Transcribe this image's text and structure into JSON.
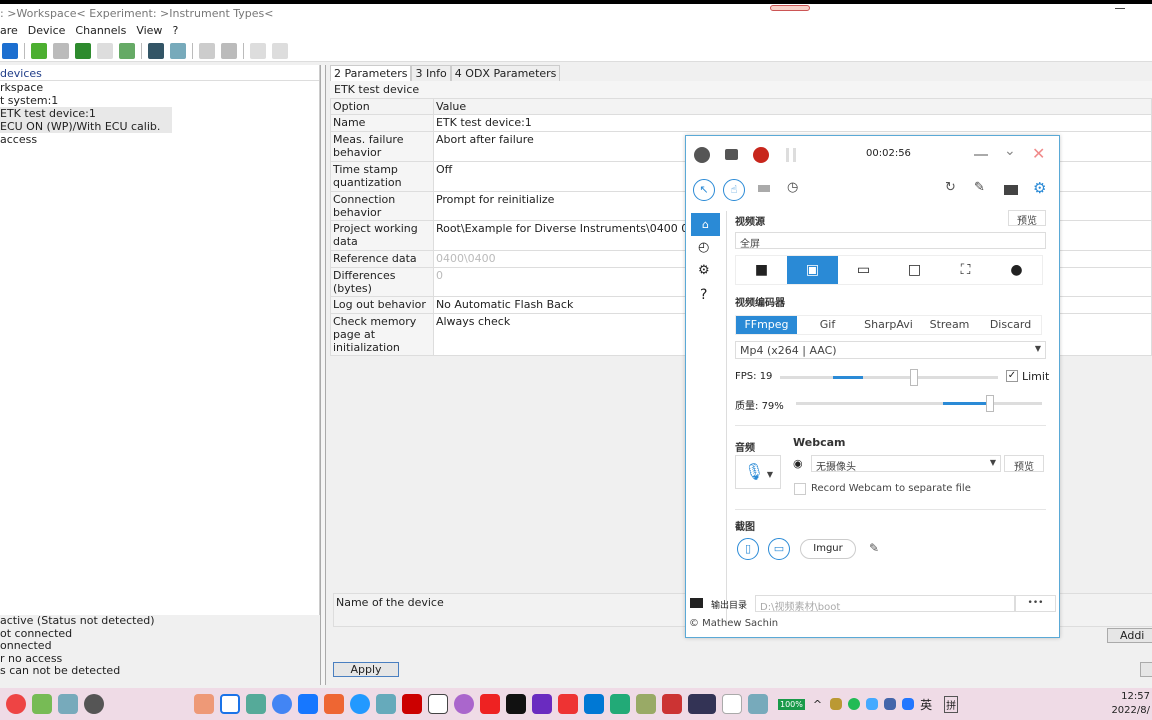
{
  "window": {
    "title": ": >Workspace<   Experiment: >Instrument Types<"
  },
  "menu": [
    "are",
    "Device",
    "Channels",
    "View",
    "?"
  ],
  "left": {
    "header": "devices",
    "tree": [
      "rkspace",
      "t system:1",
      "ETK test device:1",
      "ECU ON (WP)/With ECU calib. access"
    ],
    "status": [
      "active (Status not detected)",
      "ot connected",
      "onnected",
      "r no access",
      "s can not be detected"
    ]
  },
  "tabs": [
    "2 Parameters",
    "3 Info",
    "4 ODX Parameters"
  ],
  "device_title": "ETK test device",
  "table": {
    "headers": [
      "Option",
      "Value"
    ],
    "rows": [
      {
        "option": "Name",
        "value": "ETK test device:1"
      },
      {
        "option": "Meas. failure behavior",
        "value": "Abort after failure"
      },
      {
        "option": "Time stamp quantization",
        "value": "Off"
      },
      {
        "option": "Connection behavior",
        "value": "Prompt for reinitialize"
      },
      {
        "option": "Project working data",
        "value": "Root\\Example for Diverse Instruments\\0400 0400\\0400_1"
      },
      {
        "option": "Reference data",
        "value": "0400\\0400",
        "disabled": true
      },
      {
        "option": "Differences (bytes)",
        "value": "0",
        "disabled": true
      },
      {
        "option": "Log out behavior",
        "value": "No Automatic Flash Back"
      },
      {
        "option": "Check memory page at initialization",
        "value": "Always check"
      }
    ]
  },
  "description": "Name of the device",
  "apply_label": "Apply",
  "add_label": "Addi",
  "recorder": {
    "timer": "00:02:56",
    "video_source_label": "视频源",
    "preview": "预览",
    "source_value": "全屏",
    "encoder_label": "视频编码器",
    "encoders": [
      "FFmpeg",
      "Gif",
      "SharpAvi",
      "Stream",
      "Discard"
    ],
    "active_encoder": "FFmpeg",
    "format": "Mp4 (x264 | AAC)",
    "fps_label": "FPS:",
    "fps": "19",
    "limit_label": "Limit",
    "limit_checked": true,
    "quality_label": "质量:",
    "quality": "79%",
    "quality_value": 79,
    "audio_label": "音频",
    "webcam_label": "Webcam",
    "webcam_value": "无摄像头",
    "webcam_preview": "预览",
    "separate_label": "Record Webcam to separate file",
    "screenshot_label": "截图",
    "imgur": "Imgur",
    "output_label": "输出目录",
    "output_path": "D:\\视频素材\\boot",
    "more": "•••",
    "credit": "© Mathew Sachin",
    "accent": "#2a8ad6"
  },
  "tray": {
    "battery": "100%",
    "ime1": "英",
    "ime2": "拼",
    "time": "12:57",
    "date": "2022/8/"
  }
}
